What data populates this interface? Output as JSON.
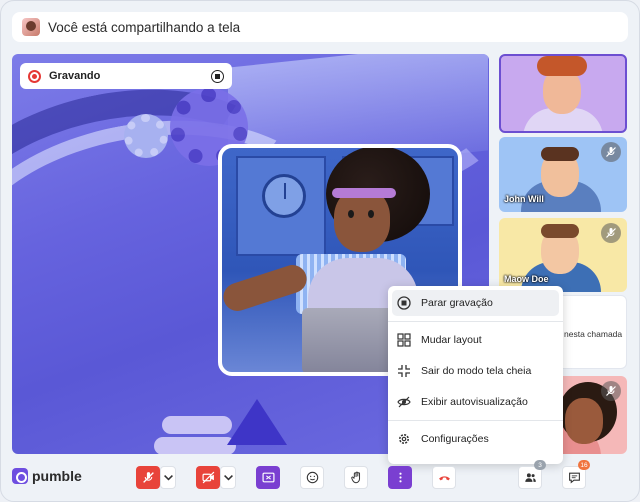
{
  "banner": {
    "text": "Você está compartilhando a tela"
  },
  "recording": {
    "label": "Gravando"
  },
  "participants": [
    {
      "name": "",
      "muted": false
    },
    {
      "name": "John Will",
      "muted": true
    },
    {
      "name": "Maow Doe",
      "muted": true
    },
    {
      "name": "",
      "status": "nesta chamada",
      "muted": false
    },
    {
      "name": "",
      "muted": true
    }
  ],
  "menu": {
    "items": [
      {
        "label": "Parar gravação",
        "icon": "stop-record-icon"
      },
      {
        "label": "Mudar layout",
        "icon": "layout-icon"
      },
      {
        "label": "Sair do modo tela cheia",
        "icon": "exit-fullscreen-icon"
      },
      {
        "label": "Exibir autovisualização",
        "icon": "hide-self-view-icon"
      },
      {
        "label": "Configurações",
        "icon": "gear-icon"
      }
    ]
  },
  "brand": {
    "name": "pumble"
  },
  "toolbar": {
    "participants_count": "3",
    "chat_count": "16"
  },
  "colors": {
    "accent": "#7a3fd1",
    "danger": "#e8433a",
    "stage": "#6663de"
  }
}
